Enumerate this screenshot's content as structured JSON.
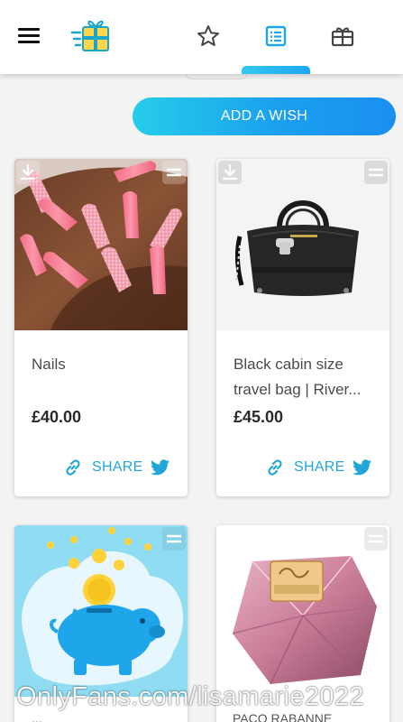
{
  "header": {
    "menu_icon": "hamburger-menu-icon",
    "logo_icon": "flying-gift-logo",
    "tabs": [
      {
        "name": "favourites",
        "icon": "star-icon"
      },
      {
        "name": "wishlist",
        "icon": "list-icon",
        "active": true
      },
      {
        "name": "gifts",
        "icon": "gift-box-icon"
      }
    ]
  },
  "actions": {
    "add_wish_label": "ADD A WISH"
  },
  "wishes": [
    {
      "title": "Nails",
      "price": "£40.00",
      "share_label": "SHARE",
      "image": "pink-glitter-nails"
    },
    {
      "title": "Black cabin size travel bag | River...",
      "price": "£45.00",
      "share_label": "SHARE",
      "image": "black-travel-bag"
    },
    {
      "title": "",
      "price": "",
      "share_label": "",
      "image": "piggy-bank-illustration"
    },
    {
      "title": "",
      "price": "",
      "share_label": "",
      "image": "lady-million-perfume"
    }
  ],
  "partial_titles": [
    "...",
    "PACO RABANNE"
  ],
  "watermark": "OnlyFans.com/lisamarie2022",
  "colors": {
    "accent": "#1da6f3",
    "share": "#23a6d7",
    "button_start": "#26cde9",
    "button_end": "#1a8ff0"
  }
}
